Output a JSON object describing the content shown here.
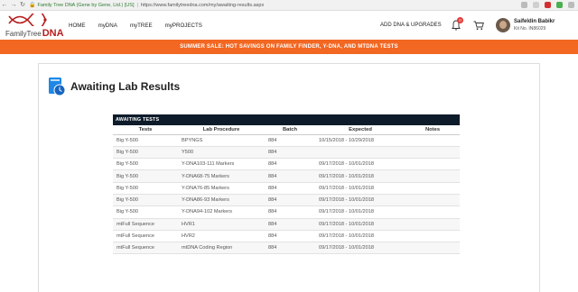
{
  "browser": {
    "site_label": "Family Tree DNA (Gene by Gene, Ltd.) [US]",
    "url": "https://www.familytreedna.com/my/awaiting-results.aspx"
  },
  "header": {
    "logo_text_prefix": "FamilyTree",
    "logo_text_suffix": "DNA",
    "nav": [
      "HOME",
      "myDNA",
      "myTREE",
      "myPROJECTS"
    ],
    "add_dna_label": "ADD DNA & UPGRADES",
    "notification_count": "0",
    "user_name": "Saifeldin Babikr",
    "user_kit": "Kit No. IN86029"
  },
  "promo": {
    "text": "SUMMER SALE: HOT SAVINGS ON FAMILY FINDER, Y-DNA, AND MTDNA TESTS"
  },
  "page": {
    "title": "Awaiting Lab Results"
  },
  "table": {
    "caption": "AWAITING TESTS",
    "columns": [
      "Tests",
      "Lab Procedure",
      "Batch",
      "Expected",
      "Notes"
    ],
    "rows": [
      {
        "test": "Big Y-500",
        "procedure": "BPYNGS",
        "batch": "884",
        "expected": "10/15/2018 - 10/29/2018",
        "notes": ""
      },
      {
        "test": "Big Y-500",
        "procedure": "Y500",
        "batch": "884",
        "expected": "",
        "notes": ""
      },
      {
        "test": "Big Y-500",
        "procedure": "Y-DNA103-111 Markers",
        "batch": "884",
        "expected": "09/17/2018 - 10/01/2018",
        "notes": ""
      },
      {
        "test": "Big Y-500",
        "procedure": "Y-DNA68-75 Markers",
        "batch": "884",
        "expected": "09/17/2018 - 10/01/2018",
        "notes": ""
      },
      {
        "test": "Big Y-500",
        "procedure": "Y-DNA76-85 Markers",
        "batch": "884",
        "expected": "09/17/2018 - 10/01/2018",
        "notes": ""
      },
      {
        "test": "Big Y-500",
        "procedure": "Y-DNA86-93 Markers",
        "batch": "884",
        "expected": "09/17/2018 - 10/01/2018",
        "notes": ""
      },
      {
        "test": "Big Y-500",
        "procedure": "Y-DNA94-102 Markers",
        "batch": "884",
        "expected": "09/17/2018 - 10/01/2018",
        "notes": ""
      },
      {
        "test": "mtFull Sequence",
        "procedure": "HVR1",
        "batch": "884",
        "expected": "09/17/2018 - 10/01/2018",
        "notes": ""
      },
      {
        "test": "mtFull Sequence",
        "procedure": "HVR2",
        "batch": "884",
        "expected": "09/17/2018 - 10/01/2018",
        "notes": ""
      },
      {
        "test": "mtFull Sequence",
        "procedure": "mtDNA Coding Region",
        "batch": "884",
        "expected": "09/17/2018 - 10/01/2018",
        "notes": ""
      }
    ]
  },
  "colors": {
    "promo_bg": "#f26722",
    "table_caption_bg": "#0d1b2a",
    "logo_red": "#b71c1c"
  }
}
